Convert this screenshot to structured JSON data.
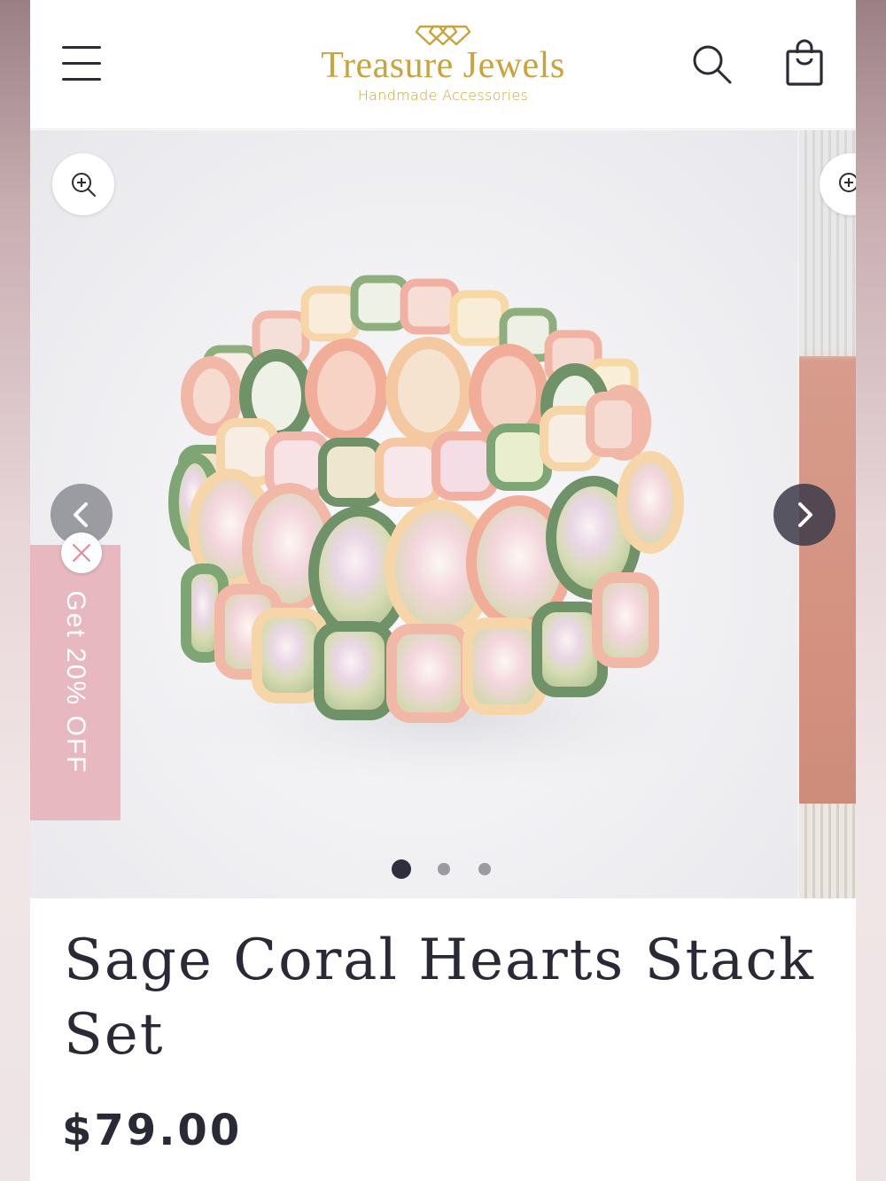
{
  "header": {
    "brand_name": "Treasure Jewels",
    "brand_tagline": "Handmade Accessories",
    "brand_color": "#c9a43c",
    "menu_icon": "hamburger-menu-icon",
    "search_icon": "search-icon",
    "cart_icon": "shopping-bag-icon"
  },
  "gallery": {
    "image_count": 3,
    "active_index": 1,
    "zoom_icon": "zoom-in-icon",
    "prev_icon": "chevron-left-icon",
    "next_icon": "chevron-right-icon"
  },
  "promo": {
    "label": "Get 20% OFF",
    "color": "#e7b8c0",
    "close_icon": "close-icon"
  },
  "product": {
    "title": "Sage Coral Hearts Stack Set",
    "price": "$79.00"
  }
}
